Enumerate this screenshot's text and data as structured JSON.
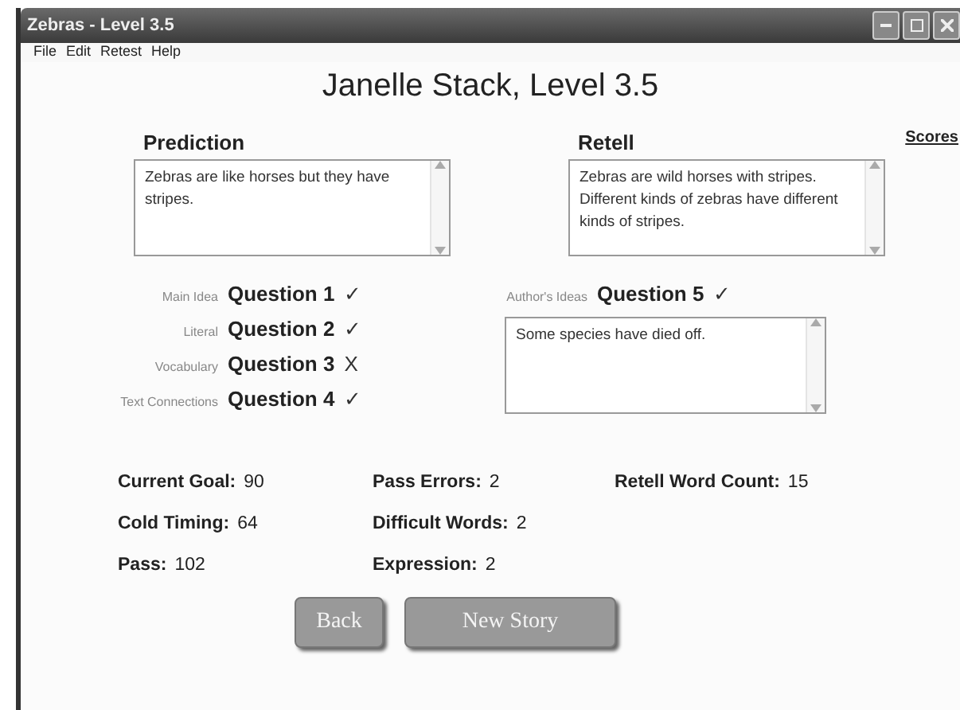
{
  "window": {
    "title": "Zebras - Level 3.5"
  },
  "menu": [
    "File",
    "Edit",
    "Retest",
    "Help"
  ],
  "heading": "Janelle Stack, Level 3.5",
  "scores_link": "Scores",
  "prediction": {
    "label": "Prediction",
    "value": "Zebras are like horses but they have stripes."
  },
  "retell": {
    "label": "Retell",
    "value": "Zebras are wild horses with stripes. Different kinds of zebras have different kinds of stripes."
  },
  "questions": [
    {
      "category": "Main Idea",
      "label": "Question 1",
      "mark": "✓"
    },
    {
      "category": "Literal",
      "label": "Question 2",
      "mark": "✓"
    },
    {
      "category": "Vocabulary",
      "label": "Question 3",
      "mark": "X"
    },
    {
      "category": "Text Connections",
      "label": "Question 4",
      "mark": "✓"
    }
  ],
  "author_question": {
    "category": "Author's Ideas",
    "label": "Question 5",
    "mark": "✓",
    "answer": "Some species have died off."
  },
  "stats": [
    {
      "label": "Current Goal:",
      "value": "90"
    },
    {
      "label": "Pass Errors:",
      "value": "2"
    },
    {
      "label": "Retell Word Count:",
      "value": "15"
    },
    {
      "label": "Cold Timing:",
      "value": "64"
    },
    {
      "label": "Difficult Words:",
      "value": "2"
    },
    {
      "label": "Pass:",
      "value": "102"
    },
    {
      "label": "Expression:",
      "value": "2"
    }
  ],
  "buttons": [
    "Back",
    "New Story"
  ]
}
